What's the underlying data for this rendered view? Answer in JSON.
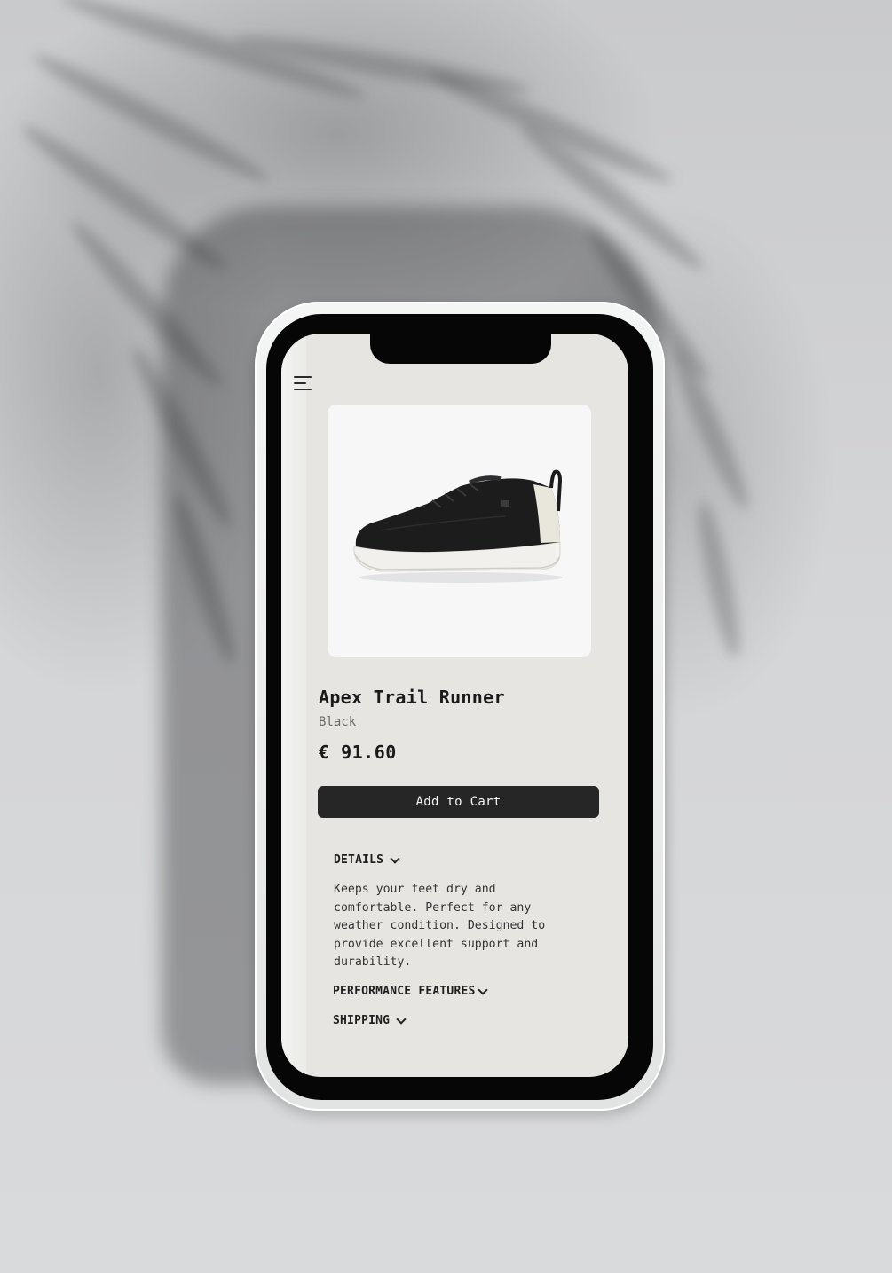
{
  "product": {
    "name": "Apex Trail Runner",
    "color": "Black",
    "price": "€ 91.60",
    "image_icon": "sneaker-image"
  },
  "actions": {
    "add_to_cart_label": "Add to Cart"
  },
  "navigation": {
    "menu_icon": "hamburger-menu-icon"
  },
  "accordion": {
    "details": {
      "label": "DETAILS",
      "expanded": true,
      "body": "Keeps your feet dry and comfortable. Perfect for any weather condition. Designed to provide excellent support and durability."
    },
    "performance": {
      "label": "PERFORMANCE FEATURES",
      "expanded": false
    },
    "shipping": {
      "label": "SHIPPING",
      "expanded": false
    }
  },
  "colors": {
    "screen_background": "#e6e5e1",
    "button_background": "#262626",
    "button_text": "#f4f4f4",
    "card_background": "#f7f7f8"
  }
}
